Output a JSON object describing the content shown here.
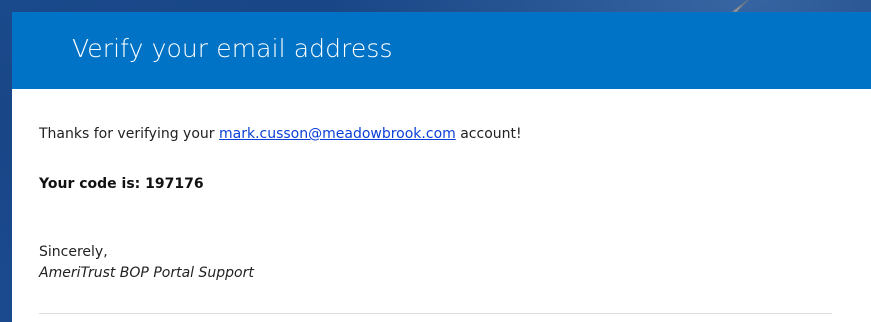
{
  "email": {
    "title": "Verify your email address",
    "intro_prefix": "Thanks for verifying your ",
    "email_address": "mark.cusson@meadowbrook.com",
    "intro_suffix": " account!",
    "code_text": "Your code is: 197176",
    "closing": "Sincerely,",
    "signature": "AmeriTrust BOP Portal Support"
  },
  "colors": {
    "header_blue": "#0073c6",
    "link_blue": "#0b3fd8",
    "background_blue": "#14407e"
  },
  "icons": {
    "pointer": "arrow-pointer-icon"
  }
}
